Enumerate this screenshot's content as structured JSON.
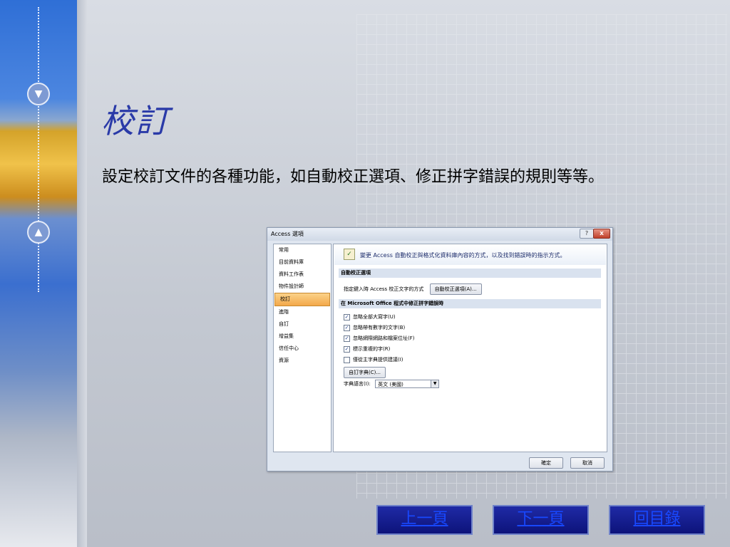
{
  "slide": {
    "title": "校訂",
    "body": "設定校訂文件的各種功能，如自動校正選項、修正拼字錯誤的規則等等。"
  },
  "dialog": {
    "title": "Access 選項",
    "help": "?",
    "close": "x",
    "nav_items": [
      "常用",
      "目前資料庫",
      "資料工作表",
      "物件設計師",
      "校訂",
      "進階",
      "自訂",
      "增益集",
      "信任中心",
      "資源"
    ],
    "selected_nav": "校訂",
    "header_text": "變更 Access 自動校正與格式化資料庫內容的方式，以及找到錯誤時的指示方式。",
    "section1": "自動校正選項",
    "autocorrect_label": "指定鍵入時 Access 校正文字的方式",
    "autocorrect_button": "自動校正選項(A)...",
    "section2": "在 Microsoft Office 程式中修正拼字錯誤時",
    "checks": [
      {
        "label": "忽略全部大寫字(U)",
        "checked": true
      },
      {
        "label": "忽略帶有數字的文字(B)",
        "checked": true
      },
      {
        "label": "忽略網際網路和檔案位址(F)",
        "checked": true
      },
      {
        "label": "標示重複的字(R)",
        "checked": true
      },
      {
        "label": "僅從主字典提供建議(I)",
        "checked": false
      }
    ],
    "custom_dict_button": "自訂字典(C)...",
    "dict_lang_label": "字典語言(I):",
    "dict_lang_value": "英文 (美國)",
    "ok": "確定",
    "cancel": "取消"
  },
  "nav_buttons": {
    "prev": "上一頁",
    "next": "下一頁",
    "toc": "回目錄"
  }
}
